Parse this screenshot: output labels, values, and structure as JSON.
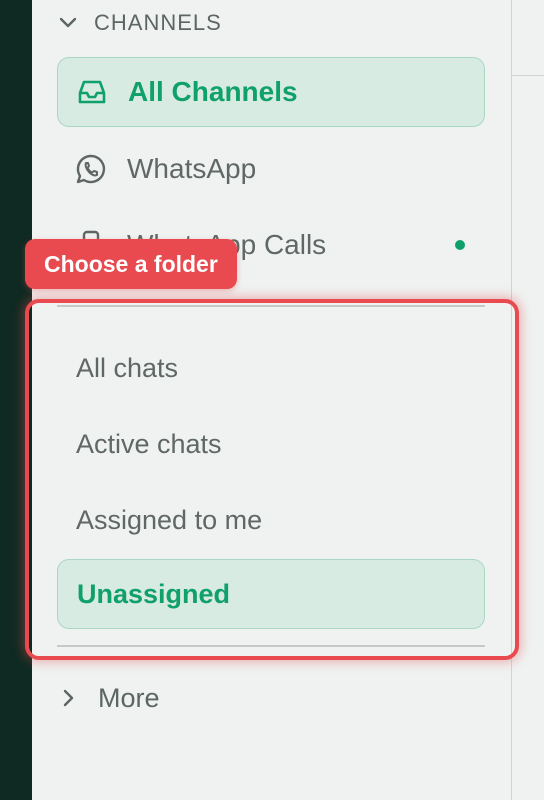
{
  "channels": {
    "section_title": "CHANNELS",
    "items": [
      {
        "label": "All Channels",
        "icon": "inbox-icon",
        "active": true
      },
      {
        "label": "WhatsApp",
        "icon": "whatsapp-icon",
        "active": false
      },
      {
        "label": "WhatsApp Calls",
        "icon": "phone-icon",
        "active": false,
        "status_dot": true
      }
    ]
  },
  "annotation": {
    "callout_label": "Choose a folder"
  },
  "folders": {
    "items": [
      {
        "label": "All chats",
        "active": false
      },
      {
        "label": "Active chats",
        "active": false
      },
      {
        "label": "Assigned to me",
        "active": false
      },
      {
        "label": "Unassigned",
        "active": true
      }
    ]
  },
  "more": {
    "label": "More"
  },
  "colors": {
    "accent": "#10a06b",
    "active_bg": "#d7ebe3",
    "highlight": "#e84a4f",
    "rail": "#0f2a22"
  }
}
